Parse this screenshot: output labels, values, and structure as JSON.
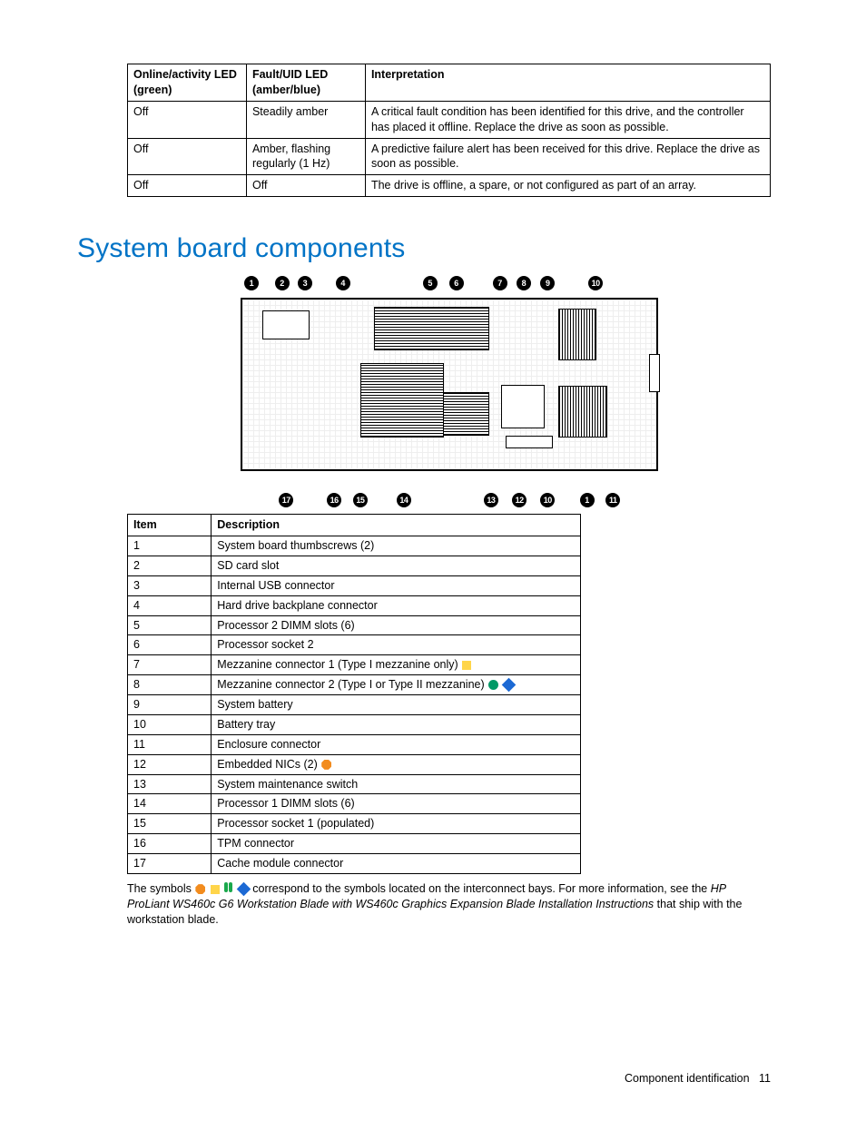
{
  "ledTable": {
    "headers": [
      "Online/activity LED (green)",
      "Fault/UID LED (amber/blue)",
      "Interpretation"
    ],
    "rows": [
      {
        "c1": "Off",
        "c2": "Steadily amber",
        "c3": "A critical fault condition has been identified for this drive, and the controller has placed it offline. Replace the drive as soon as possible."
      },
      {
        "c1": "Off",
        "c2": "Amber, flashing regularly (1 Hz)",
        "c3": "A predictive failure alert has been received for this drive. Replace the drive as soon as possible."
      },
      {
        "c1": "Off",
        "c2": "Off",
        "c3": "The drive is offline, a spare, or not configured as part of an array."
      }
    ]
  },
  "sectionHeading": "System board components",
  "diagram": {
    "topCallouts": [
      "1",
      "2",
      "3",
      "4",
      "5",
      "6",
      "7",
      "8",
      "9",
      "10"
    ],
    "bottomCallouts": [
      "17",
      "16",
      "15",
      "14",
      "13",
      "12",
      "10",
      "1",
      "11"
    ]
  },
  "compTable": {
    "headers": [
      "Item",
      "Description"
    ],
    "rows": [
      {
        "item": "1",
        "desc": "System board thumbscrews (2)",
        "sym": []
      },
      {
        "item": "2",
        "desc": "SD card slot",
        "sym": []
      },
      {
        "item": "3",
        "desc": "Internal USB connector",
        "sym": []
      },
      {
        "item": "4",
        "desc": "Hard drive backplane connector",
        "sym": []
      },
      {
        "item": "5",
        "desc": "Processor 2 DIMM slots (6)",
        "sym": []
      },
      {
        "item": "6",
        "desc": "Processor socket 2",
        "sym": []
      },
      {
        "item": "7",
        "desc": "Mezzanine connector 1 (Type I mezzanine only)",
        "sym": [
          "square"
        ]
      },
      {
        "item": "8",
        "desc": "Mezzanine connector 2 (Type I or Type II mezzanine)",
        "sym": [
          "circle",
          "diamond"
        ]
      },
      {
        "item": "9",
        "desc": "System battery",
        "sym": []
      },
      {
        "item": "10",
        "desc": "Battery tray",
        "sym": []
      },
      {
        "item": "11",
        "desc": "Enclosure connector",
        "sym": []
      },
      {
        "item": "12",
        "desc": "Embedded NICs (2)",
        "sym": [
          "octagon"
        ]
      },
      {
        "item": "13",
        "desc": "System maintenance switch",
        "sym": []
      },
      {
        "item": "14",
        "desc": "Processor 1 DIMM slots (6)",
        "sym": []
      },
      {
        "item": "15",
        "desc": "Processor socket 1 (populated)",
        "sym": []
      },
      {
        "item": "16",
        "desc": "TPM connector",
        "sym": []
      },
      {
        "item": "17",
        "desc": "Cache module connector",
        "sym": []
      }
    ]
  },
  "footnote": {
    "lead": "The symbols ",
    "mid": " correspond to the symbols located on the interconnect bays. For more information, see the ",
    "italic": "HP ProLiant WS460c G6 Workstation Blade with WS460c Graphics Expansion Blade Installation Instructions",
    "tail": " that ship with the workstation blade."
  },
  "footer": {
    "section": "Component identification",
    "page": "11"
  }
}
